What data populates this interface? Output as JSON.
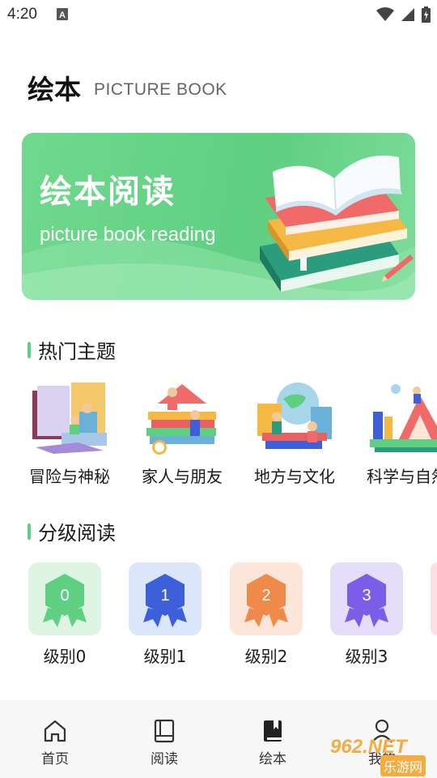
{
  "status": {
    "time": "4:20"
  },
  "header": {
    "title": "绘本",
    "subtitle": "PICTURE BOOK"
  },
  "banner": {
    "title": "绘本阅读",
    "subtitle": "picture book reading"
  },
  "sections": {
    "hot_topics": "热门主题",
    "graded_reading": "分级阅读"
  },
  "topics": [
    {
      "label": "冒险与神秘"
    },
    {
      "label": "家人与朋友"
    },
    {
      "label": "地方与文化"
    },
    {
      "label": "科学与自然"
    }
  ],
  "levels": [
    {
      "label": "级别0",
      "number": "0",
      "bg": "#def5e4",
      "color": "#5fcf82"
    },
    {
      "label": "级别1",
      "number": "1",
      "bg": "#dce6fb",
      "color": "#3d5fd9"
    },
    {
      "label": "级别2",
      "number": "2",
      "bg": "#fde6d9",
      "color": "#f08a4b"
    },
    {
      "label": "级别3",
      "number": "3",
      "bg": "#e4defb",
      "color": "#7b5ee8"
    }
  ],
  "nav": {
    "items": [
      {
        "label": "首页",
        "icon": "home-icon"
      },
      {
        "label": "阅读",
        "icon": "book-icon"
      },
      {
        "label": "绘本",
        "icon": "picture-book-icon",
        "active": true
      },
      {
        "label": "我的",
        "icon": "profile-icon"
      }
    ]
  },
  "watermark": {
    "text": "962.NET",
    "text2": "乐游网"
  },
  "colors": {
    "accent": "#5fcf82",
    "banner": "#6fd98e"
  }
}
